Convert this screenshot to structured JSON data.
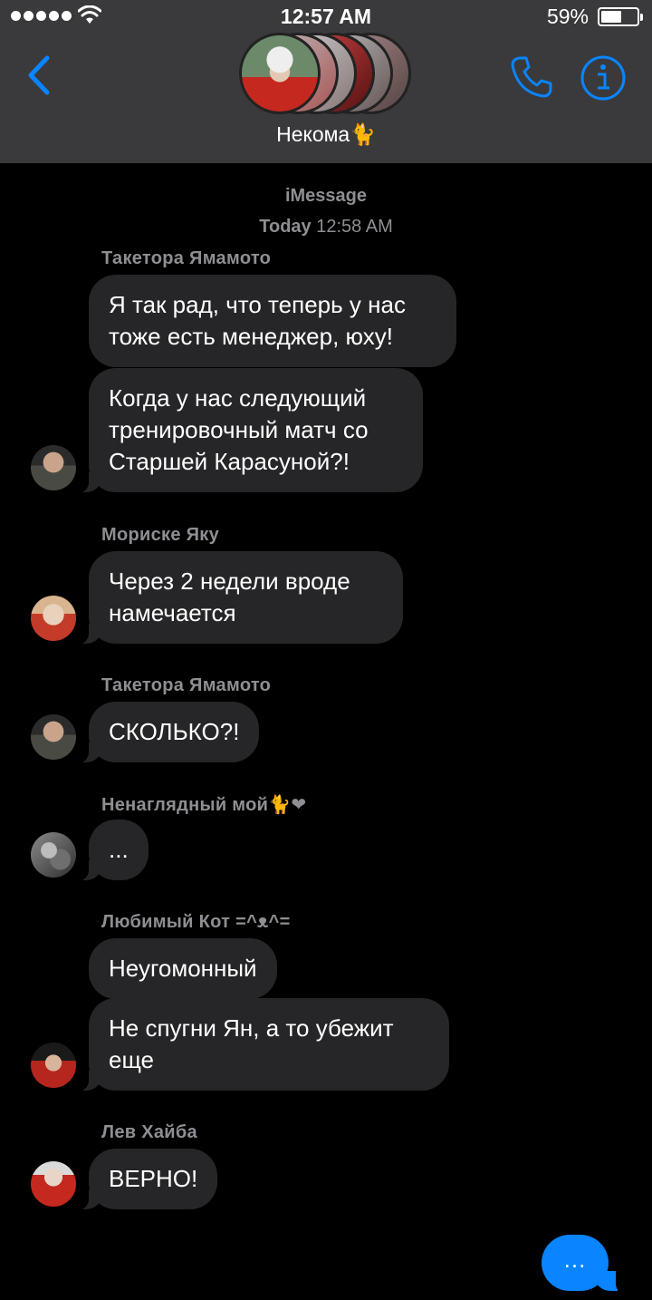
{
  "status_bar": {
    "time": "12:57 AM",
    "battery_percent": "59%",
    "battery_level": 0.59,
    "signal_bars": 5
  },
  "header": {
    "back_icon": "chevron-left-icon",
    "call_icon": "phone-icon",
    "info_icon": "info-icon",
    "title": "Некома🐈",
    "accent_color": "#0a84ff"
  },
  "thread": {
    "service": "iMessage",
    "date_prefix": "Today",
    "date_time": "12:58 AM"
  },
  "messages": [
    {
      "sender": "Такетора Ямамото",
      "bubbles": [
        "Я так рад, что теперь у нас тоже есть менеджер, юху!",
        "Когда у нас следующий тренировочный матч со Старшей Карасуной?!"
      ]
    },
    {
      "sender": "Мориске Яку",
      "bubbles": [
        "Через 2 недели вроде намечается"
      ]
    },
    {
      "sender": "Такетора Ямамото",
      "bubbles": [
        "СКОЛЬКО?!"
      ]
    },
    {
      "sender": "Ненаглядный мой🐈❤",
      "bubbles": [
        "..."
      ]
    },
    {
      "sender": "Любимый Кот =^ᴥ^=",
      "bubbles": [
        "Неугомонный",
        "Не спугни Ян, а то убежит еще"
      ]
    },
    {
      "sender": "Лев Хайба",
      "bubbles": [
        "ВЕРНО!"
      ]
    }
  ],
  "typing_indicator": {
    "text": "...",
    "color": "#0a84ff"
  },
  "colors": {
    "background": "#000000",
    "header": "#3a3a3c",
    "bubble": "#262628",
    "meta_text": "#8e8e93"
  }
}
